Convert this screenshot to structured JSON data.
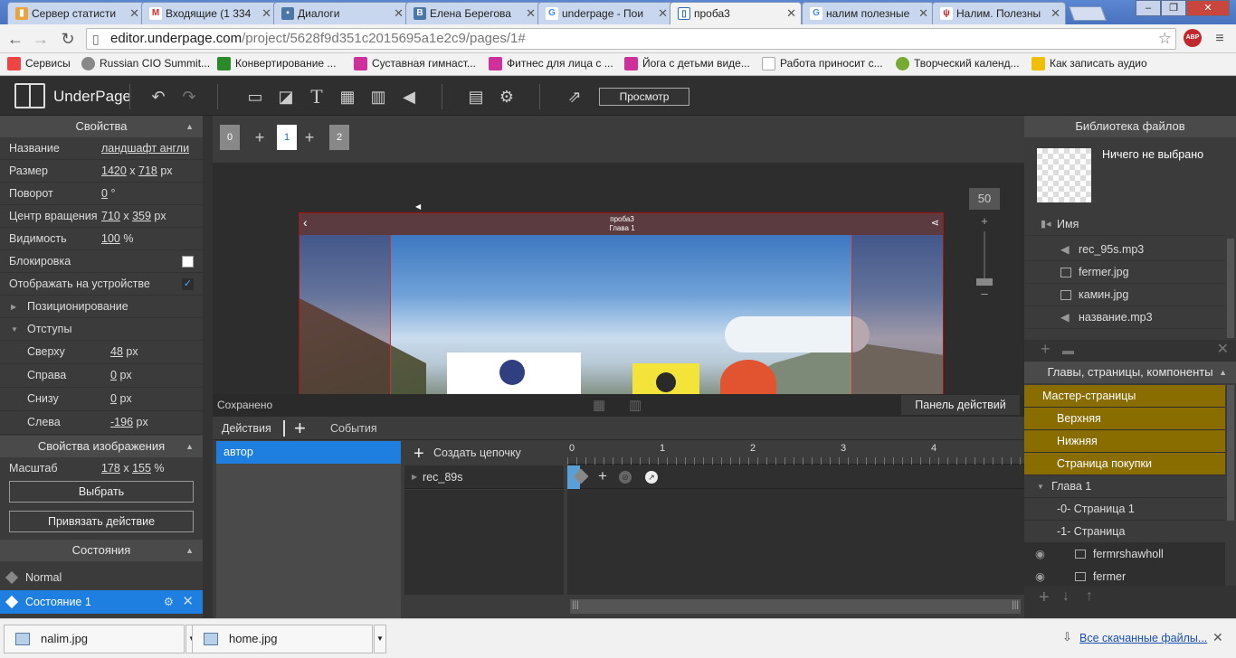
{
  "browser": {
    "tabs": [
      {
        "label": "Сервер статисти",
        "icon": "chart-favicon",
        "color": "#e8a33c"
      },
      {
        "label": "Входящие (1 334",
        "icon": "gmail-favicon",
        "color": "#d93025"
      },
      {
        "label": "Диалоги",
        "icon": "chat-favicon",
        "color": "#4a76a8"
      },
      {
        "label": "Елена Берегова",
        "icon": "vk-favicon",
        "color": "#4a76a8"
      },
      {
        "label": "underpage - Пои",
        "icon": "google-favicon",
        "color": "#4285f4"
      },
      {
        "label": "проба3",
        "icon": "book-favicon",
        "color": "#2b6cb0"
      },
      {
        "label": "налим полезные",
        "icon": "google-favicon",
        "color": "#4285f4"
      },
      {
        "label": "Налим. Полезны",
        "icon": "fork-favicon",
        "color": "#b22"
      }
    ],
    "url_host": "editor.underpage.com",
    "url_path": "/project/5628f9d351c2015695a1e2c9/pages/1#",
    "bookmarks": [
      {
        "label": "Сервисы",
        "color": "#e44"
      },
      {
        "label": "Russian CIO Summit...",
        "color": "#888"
      },
      {
        "label": "Конвертирование ...",
        "color": "#2a8a2a"
      },
      {
        "label": "Суставная гимнаст...",
        "color": "#d0309b"
      },
      {
        "label": "Фитнес для лица с ...",
        "color": "#d0309b"
      },
      {
        "label": "Йога с детьми виде...",
        "color": "#d0309b"
      },
      {
        "label": "Работа приносит с...",
        "color": "#ccc"
      },
      {
        "label": "Творческий календ...",
        "color": "#7a3"
      },
      {
        "label": "Как записать аудио",
        "color": "#f0c000"
      }
    ]
  },
  "editor": {
    "logo": "UnderPage",
    "preview_label": "Просмотр"
  },
  "left": {
    "properties_title": "Свойства",
    "name_label": "Название",
    "name_value": "ландшафт англи",
    "size_label": "Размер",
    "size_w": "1420",
    "size_h": "718",
    "size_unit": "px",
    "rotation_label": "Поворот",
    "rotation_value": "0",
    "rotation_unit": "°",
    "pivot_label": "Центр вращения",
    "pivot_x": "710",
    "pivot_y": "359",
    "pivot_unit": "px",
    "visibility_label": "Видимость",
    "visibility_value": "100",
    "visibility_unit": "%",
    "lock_label": "Блокировка",
    "device_label": "Отображать на устройстве",
    "positioning_label": "Позиционирование",
    "padding_label": "Отступы",
    "top_label": "Сверху",
    "top_value": "48",
    "right_label": "Справа",
    "right_value": "0",
    "bottom_label": "Снизу",
    "bottom_value": "0",
    "leftpad_label": "Слева",
    "leftpad_value": "-196",
    "px": "px",
    "image_props_title": "Свойства изображения",
    "scale_label": "Масштаб",
    "scale_x": "178",
    "scale_y": "155",
    "scale_unit": "%",
    "choose_button": "Выбрать",
    "bind_action_button": "Привязать действие",
    "states_title": "Состояния",
    "state_normal": "Normal",
    "state_1": "Состояние 1"
  },
  "canvas": {
    "pages": [
      "0",
      "1",
      "2"
    ],
    "art_title": "проба3",
    "art_subtitle": "Глава 1",
    "zoom_value": "50"
  },
  "bottom": {
    "status": "Сохранено",
    "action_panel_button": "Панель действий",
    "tab_actions": "Действия",
    "tab_events": "События",
    "actor_item": "автор",
    "create_chain": "Создать цепочку",
    "track_name": "rec_89s",
    "ruler": [
      "0",
      "1",
      "2",
      "3",
      "4"
    ]
  },
  "right": {
    "library_title": "Библиотека файлов",
    "nothing_selected": "Ничего не выбрано",
    "name_column": "Имя",
    "files": [
      {
        "name": "rec_95s.mp3",
        "type": "audio"
      },
      {
        "name": "fermer.jpg",
        "type": "image"
      },
      {
        "name": "камин.jpg",
        "type": "image"
      },
      {
        "name": "название.mp3",
        "type": "audio"
      }
    ],
    "chapters_title": "Главы, страницы, компоненты",
    "master_pages": "Мастер-страницы",
    "master_items": [
      "Верхняя",
      "Нижняя",
      "Страница покупки"
    ],
    "chapter": "Глава 1",
    "pages": [
      "-0-  Страница 1",
      "-1-  Страница"
    ],
    "components": [
      "fermrshawholl",
      "fermer"
    ]
  },
  "downloads": {
    "items": [
      "nalim.jpg",
      "home.jpg"
    ],
    "all_label": "Все скачанные файлы..."
  }
}
